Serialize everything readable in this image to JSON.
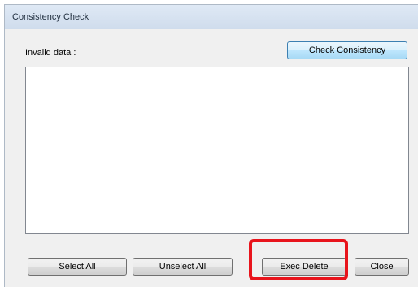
{
  "window": {
    "title": "Consistency Check"
  },
  "labels": {
    "invalid_data": "Invalid data :"
  },
  "buttons": {
    "check_consistency": "Check Consistency",
    "select_all": "Select All",
    "unselect_all": "Unselect All",
    "exec_delete": "Exec Delete",
    "close": "Close"
  },
  "list": {
    "items": []
  },
  "colors": {
    "highlight": "#e8141c",
    "titlebar": "#cfdcec"
  }
}
